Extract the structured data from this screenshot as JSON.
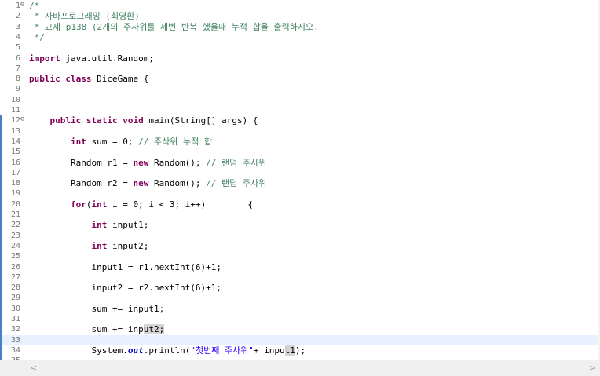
{
  "editor": {
    "lines": [
      {
        "n": "1",
        "fold": "⊖",
        "parts": [
          [
            "cm",
            "/*"
          ]
        ]
      },
      {
        "n": "2",
        "parts": [
          [
            "cm",
            " * 자바프로그래밍 (최영환)"
          ]
        ]
      },
      {
        "n": "3",
        "parts": [
          [
            "cm",
            " * 교제 p138 (2개의 주사위를 세번 반복 했을때 누적 합을 출력하시오."
          ]
        ]
      },
      {
        "n": "4",
        "parts": [
          [
            "cm",
            " */"
          ]
        ]
      },
      {
        "n": "5",
        "parts": []
      },
      {
        "n": "6",
        "parts": [
          [
            "kw",
            "import"
          ],
          [
            "t",
            " java.util.Random;"
          ]
        ]
      },
      {
        "n": "7",
        "parts": []
      },
      {
        "n": "8",
        "parts": [
          [
            "kw",
            "public"
          ],
          [
            "t",
            " "
          ],
          [
            "kw",
            "class"
          ],
          [
            "t",
            " DiceGame {"
          ]
        ]
      },
      {
        "n": "9",
        "parts": []
      },
      {
        "n": "10",
        "parts": []
      },
      {
        "n": "11",
        "parts": []
      },
      {
        "n": "12",
        "fold": "⊖",
        "mark": true,
        "parts": [
          [
            "t",
            "    "
          ],
          [
            "kw",
            "public"
          ],
          [
            "t",
            " "
          ],
          [
            "kw",
            "static"
          ],
          [
            "t",
            " "
          ],
          [
            "kw",
            "void"
          ],
          [
            "t",
            " main(String[] args) {"
          ]
        ]
      },
      {
        "n": "13",
        "mark": true,
        "parts": []
      },
      {
        "n": "14",
        "mark": true,
        "parts": [
          [
            "t",
            "        "
          ],
          [
            "kw",
            "int"
          ],
          [
            "t",
            " sum = 0; "
          ],
          [
            "cm",
            "// 주삭위 누적 합"
          ]
        ]
      },
      {
        "n": "15",
        "mark": true,
        "parts": []
      },
      {
        "n": "16",
        "mark": true,
        "parts": [
          [
            "t",
            "        Random r1 = "
          ],
          [
            "kw",
            "new"
          ],
          [
            "t",
            " Random(); "
          ],
          [
            "cm",
            "// 랜덤 주사위"
          ]
        ]
      },
      {
        "n": "17",
        "mark": true,
        "parts": []
      },
      {
        "n": "18",
        "mark": true,
        "parts": [
          [
            "t",
            "        Random r2 = "
          ],
          [
            "kw",
            "new"
          ],
          [
            "t",
            " Random(); "
          ],
          [
            "cm",
            "// 랜덤 주사위"
          ]
        ]
      },
      {
        "n": "19",
        "mark": true,
        "parts": []
      },
      {
        "n": "20",
        "mark": true,
        "parts": [
          [
            "t",
            "        "
          ],
          [
            "kw",
            "for"
          ],
          [
            "t",
            "("
          ],
          [
            "kw",
            "int"
          ],
          [
            "t",
            " i = 0; i < 3; i++)        {"
          ]
        ]
      },
      {
        "n": "21",
        "mark": true,
        "parts": []
      },
      {
        "n": "22",
        "mark": true,
        "parts": [
          [
            "t",
            "            "
          ],
          [
            "kw",
            "int"
          ],
          [
            "t",
            " input1;"
          ]
        ]
      },
      {
        "n": "23",
        "mark": true,
        "parts": []
      },
      {
        "n": "24",
        "mark": true,
        "parts": [
          [
            "t",
            "            "
          ],
          [
            "kw",
            "int"
          ],
          [
            "t",
            " input2;"
          ]
        ]
      },
      {
        "n": "25",
        "mark": true,
        "parts": []
      },
      {
        "n": "26",
        "mark": true,
        "parts": [
          [
            "t",
            "            input1 = r1.nextInt(6)+1;"
          ]
        ]
      },
      {
        "n": "27",
        "mark": true,
        "parts": []
      },
      {
        "n": "28",
        "mark": true,
        "parts": [
          [
            "t",
            "            input2 = r2.nextInt(6)+1;"
          ]
        ]
      },
      {
        "n": "29",
        "mark": true,
        "parts": []
      },
      {
        "n": "30",
        "mark": true,
        "parts": [
          [
            "t",
            "            sum += input1;"
          ]
        ]
      },
      {
        "n": "31",
        "mark": true,
        "parts": []
      },
      {
        "n": "32",
        "mark": true,
        "parts": [
          [
            "t",
            "            sum += inp"
          ],
          [
            "hl",
            "ut2;"
          ]
        ]
      },
      {
        "n": "33",
        "mark": true,
        "current": true,
        "parts": []
      },
      {
        "n": "34",
        "mark": true,
        "parts": [
          [
            "t",
            "            System."
          ],
          [
            "st",
            "out"
          ],
          [
            "t",
            ".println("
          ],
          [
            "str",
            "\"첫번째 주사위\""
          ],
          [
            "t",
            "+ inpu"
          ],
          [
            "hl",
            "t1"
          ],
          [
            "t",
            ");"
          ]
        ]
      },
      {
        "n": "35",
        "mark": true,
        "parts": []
      }
    ]
  },
  "scrollbar": {
    "left_arrow": "<",
    "right_arrow": ">"
  }
}
